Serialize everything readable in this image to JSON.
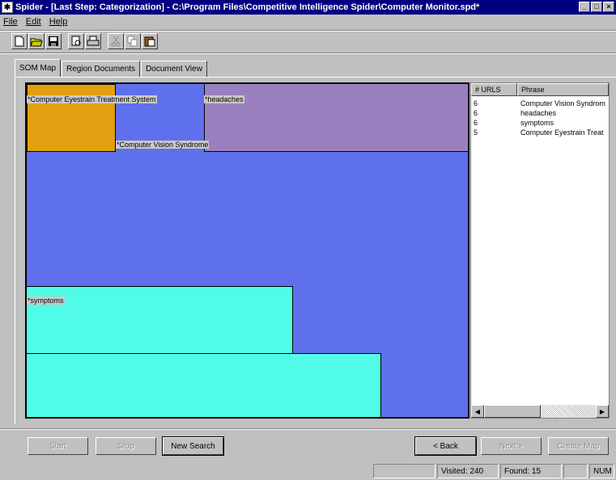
{
  "window": {
    "title": "Spider - [Last Step: Categorization] - C:\\Program Files\\Competitive Intelligence Spider\\Computer Monitor.spd*"
  },
  "menu": [
    "File",
    "Edit",
    "Help"
  ],
  "toolbar": {
    "icons": [
      "new-file-icon",
      "open-folder-icon",
      "save-icon",
      "print-preview-icon",
      "print-icon",
      "cut-icon",
      "copy-icon",
      "paste-icon"
    ]
  },
  "tabs": [
    "SOM Map",
    "Region Documents",
    "Document View"
  ],
  "som_map": {
    "background_color": "#5f70ec",
    "regions": [
      {
        "label": "*Computer Eyestrain Treatment System",
        "color": "#e0a010"
      },
      {
        "label": "*Computer Vision Syndrome",
        "color": "#5f70ec"
      },
      {
        "label": "*headaches",
        "color": "#9b80c0"
      },
      {
        "label": "*symptoms",
        "color": "#50fce8"
      }
    ]
  },
  "phrase_list": {
    "columns": [
      "# URLS",
      "Phrase"
    ],
    "rows": [
      {
        "count": "6",
        "phrase": "Computer Vision Syndrom"
      },
      {
        "count": "6",
        "phrase": "headaches"
      },
      {
        "count": "6",
        "phrase": "symptoms"
      },
      {
        "count": "5",
        "phrase": "Computer Eyestrain Treat"
      }
    ]
  },
  "buttons": {
    "start": "Start",
    "stop": "Stop",
    "new_search": "New Search",
    "back": "< Back",
    "next": "Next >",
    "create_map": "Create Map"
  },
  "status": {
    "visited": "Visited: 240",
    "found": "Found: 15",
    "num": "NUM"
  }
}
